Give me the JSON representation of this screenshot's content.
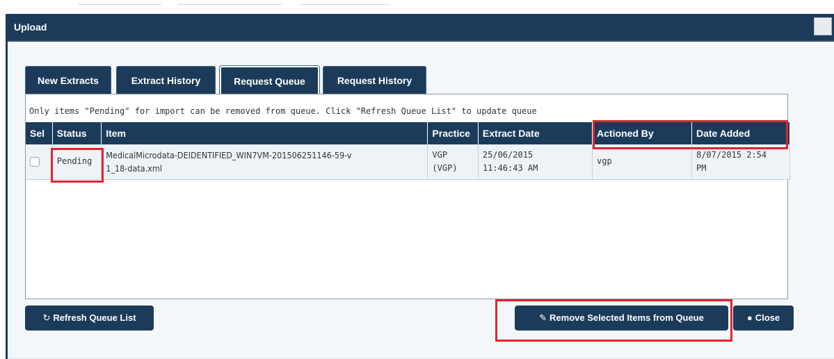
{
  "dialog": {
    "title": "Upload"
  },
  "tabs": [
    {
      "label": "New Extracts",
      "active": false
    },
    {
      "label": "Extract History",
      "active": false
    },
    {
      "label": "Request Queue",
      "active": true
    },
    {
      "label": "Request History",
      "active": false
    }
  ],
  "info_text": "Only items \"Pending\" for import can be removed from queue. Click \"Refresh Queue List\" to update queue",
  "table": {
    "headers": {
      "sel": "Sel",
      "status": "Status",
      "item": "Item",
      "practice": "Practice",
      "extract_date": "Extract Date",
      "actioned_by": "Actioned By",
      "date_added": "Date Added"
    },
    "rows": [
      {
        "status": "Pending",
        "item_line1": "MedicalMicrodata-DEIDENTIFIED_WIN7VM-201506251146-59-v",
        "item_line2": "1_18-data.xml",
        "practice_line1": "VGP",
        "practice_line2": "(VGP)",
        "extract_date_line1": "25/06/2015",
        "extract_date_line2": "11:46:43 AM",
        "actioned_by": "vgp",
        "date_added_line1": "8/07/2015 2:54",
        "date_added_line2": "PM"
      }
    ]
  },
  "buttons": {
    "refresh": "Refresh Queue List",
    "remove": "Remove Selected Items from Queue",
    "close": "Close"
  },
  "icons": {
    "refresh": "refresh-spinner-icon",
    "remove": "eraser-icon",
    "close": "circle-icon"
  },
  "colors": {
    "header_blue": "#1c3b5a",
    "row_bg": "#eef3f8",
    "annotation_red": "#e0252f"
  }
}
